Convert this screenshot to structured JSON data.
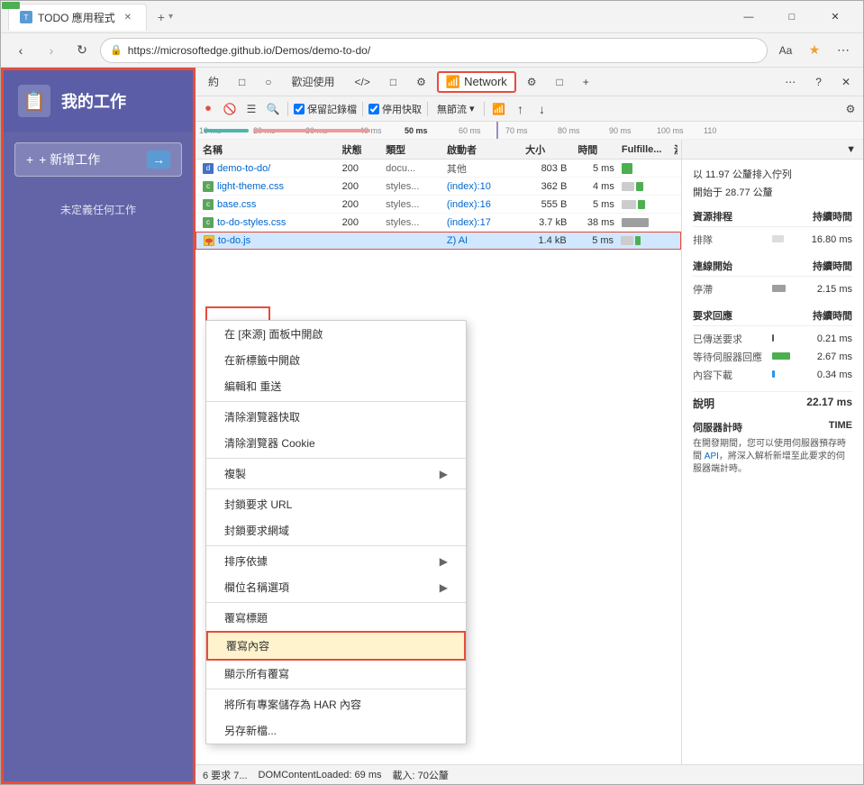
{
  "browser": {
    "tab_title": "TODO 應用程式",
    "url": "https://microsoftedge.github.io/Demos/demo-to-do/",
    "new_tab_label": "+",
    "win_minimize": "—",
    "win_restore": "□",
    "win_close": "✕"
  },
  "app": {
    "title": "我的工作",
    "icon": "📋",
    "add_button": "+ 新增工作",
    "arrow": "→",
    "empty_text": "未定義任何工作"
  },
  "devtools": {
    "tabs": [
      "約",
      "□",
      "○",
      "歡迎使用",
      "</>",
      "□",
      "⚙",
      "",
      "⚙",
      "□",
      "+"
    ],
    "network_tab": "Network",
    "toolbar2": {
      "record": "⏺",
      "clear": "🚫",
      "filter": "☰",
      "search": "🔍",
      "preserve_label": "保留記錄檔",
      "disable_label": "停用快取",
      "throttle": "無節流",
      "wifi": "📶",
      "import": "↓",
      "export": "↓",
      "settings": "⚙"
    },
    "timeline_marks": [
      "10 ms",
      "20 ms",
      "30 ms",
      "40 ms",
      "50 ms",
      "60 ms",
      "70 ms",
      "80 ms",
      "90 ms",
      "100 ms",
      "110"
    ],
    "table_headers": {
      "name": "名稱",
      "status": "狀態",
      "type": "類型",
      "initiator": "啟動者",
      "size": "大小",
      "time": "時間",
      "fulfilled": "Fulfille...",
      "waterfall": "瀑布"
    },
    "rows": [
      {
        "name": "demo-to-do/",
        "status": "200",
        "type": "docu...",
        "initiator": "其他",
        "size": "803 B",
        "time": "5 ms",
        "icon": "doc",
        "color": "#4472c4"
      },
      {
        "name": "light-theme.css",
        "status": "200",
        "type": "styles...",
        "initiator": "(index):10",
        "size": "362 B",
        "time": "4 ms",
        "icon": "css",
        "color": "#5ba55b"
      },
      {
        "name": "base.css",
        "status": "200",
        "type": "styles...",
        "initiator": "(index):16",
        "size": "555 B",
        "time": "5 ms",
        "icon": "css",
        "color": "#5ba55b"
      },
      {
        "name": "to-do-styles.css",
        "status": "200",
        "type": "styles...",
        "initiator": "(index):17",
        "size": "3.7 kB",
        "time": "38 ms",
        "icon": "css",
        "color": "#5ba55b"
      },
      {
        "name": "to-do.js",
        "status": "",
        "type": "",
        "initiator": "Z) AI",
        "size": "1.4 kB",
        "time": "5 ms",
        "icon": "js",
        "color": "#f0c040",
        "highlighted": true
      }
    ],
    "context_menu": {
      "items": [
        {
          "label": "在 [來源] 面板中開啟",
          "sub": false
        },
        {
          "label": "在新標籤中開啟",
          "sub": false
        },
        {
          "label": "編輯和  重送",
          "sub": false
        },
        {
          "label": "清除瀏覽器快取",
          "sub": false
        },
        {
          "label": "清除瀏覽器 Cookie",
          "sub": false
        },
        {
          "label": "複製",
          "sub": true
        },
        {
          "label": "封鎖要求 URL",
          "sub": false
        },
        {
          "label": "封鎖要求網域",
          "sub": false
        },
        {
          "label": "排序依據",
          "sub": true
        },
        {
          "label": "欄位名稱選項",
          "sub": true
        },
        {
          "label": "覆寫標題",
          "sub": false
        },
        {
          "label": "覆寫內容",
          "sub": false,
          "highlighted": true
        },
        {
          "label": "顯示所有覆寫",
          "sub": false
        },
        {
          "label": "將所有專案儲存為 HAR 內容",
          "sub": false
        },
        {
          "label": "另存新檔...",
          "sub": false
        }
      ]
    },
    "timing": {
      "queued_at": "以 11.97 公釐排入佇列",
      "started_at": "開始于 28.77 公釐",
      "resource_scheduling": {
        "title": "資源排程",
        "duration_label": "持續時間",
        "queue_label": "排隊",
        "queue_value": "16.80 ms"
      },
      "connection_start": {
        "title": "連線開始",
        "duration_label": "持續時間",
        "stall_label": "停滯",
        "stall_value": "2.15 ms"
      },
      "request_response": {
        "title": "要求回應",
        "duration_label": "持續時間",
        "sent_label": "已傳送要求",
        "sent_value": "0.21 ms",
        "waiting_label": "等待伺服器回應",
        "waiting_value": "2.67 ms",
        "download_label": "內容下載",
        "download_value": "0.34 ms"
      },
      "total_label": "說明",
      "total_value": "22.17 ms",
      "server_timing": {
        "title": "伺服器計時",
        "time_label": "TIME",
        "desc": "在開發期間，您可以使用伺服器預存時間 API，將深入解析新增至此要求的伺服器端計時。",
        "link_text": "API"
      }
    },
    "status_bar": {
      "requests": "6 要求 7...",
      "domcontentloaded": "DOMContentLoaded: 69 ms",
      "loaded": "載入: 70公釐"
    }
  }
}
